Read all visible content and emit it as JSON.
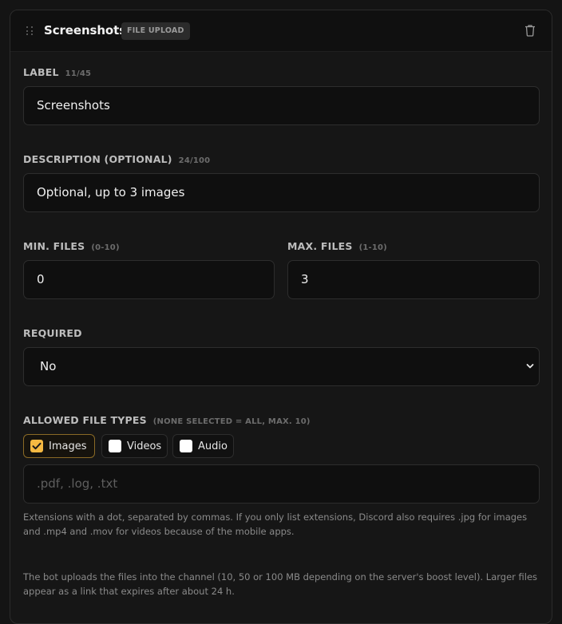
{
  "header": {
    "title": "Screenshots",
    "badge": "FILE UPLOAD"
  },
  "fields": {
    "label": {
      "label": "LABEL",
      "counter": "11/45",
      "value": "Screenshots"
    },
    "description": {
      "label": "DESCRIPTION (OPTIONAL)",
      "counter": "24/100",
      "value": "Optional, up to 3 images"
    },
    "min_files": {
      "label": "MIN. FILES",
      "range": "(0-10)",
      "value": "0"
    },
    "max_files": {
      "label": "MAX. FILES",
      "range": "(1-10)",
      "value": "3"
    },
    "required": {
      "label": "REQUIRED",
      "value": "No"
    },
    "file_types": {
      "label": "ALLOWED FILE TYPES",
      "hint": "(NONE SELECTED = ALL, MAX. 10)",
      "options": [
        {
          "label": "Images",
          "checked": true
        },
        {
          "label": "Videos",
          "checked": false
        },
        {
          "label": "Audio",
          "checked": false
        }
      ],
      "extensions_placeholder": ".pdf, .log, .txt",
      "extensions_help": "Extensions with a dot, separated by commas. If you only list extensions, Discord also requires .jpg for images and .mp4 and .mov for videos because of the mobile apps."
    }
  },
  "footer_note": "The bot uploads the files into the channel (10, 50 or 100 MB depending on the server's boost level). Larger files appear as a link that expires after about 24 h.",
  "colors": {
    "accent": "#f5b942",
    "background": "#161616",
    "input_background": "#0f0f0f"
  },
  "icons": {
    "drag": "drag-handle-icon",
    "delete": "trash-icon",
    "select": "chevron-down-icon",
    "checkmark": "check-icon"
  }
}
